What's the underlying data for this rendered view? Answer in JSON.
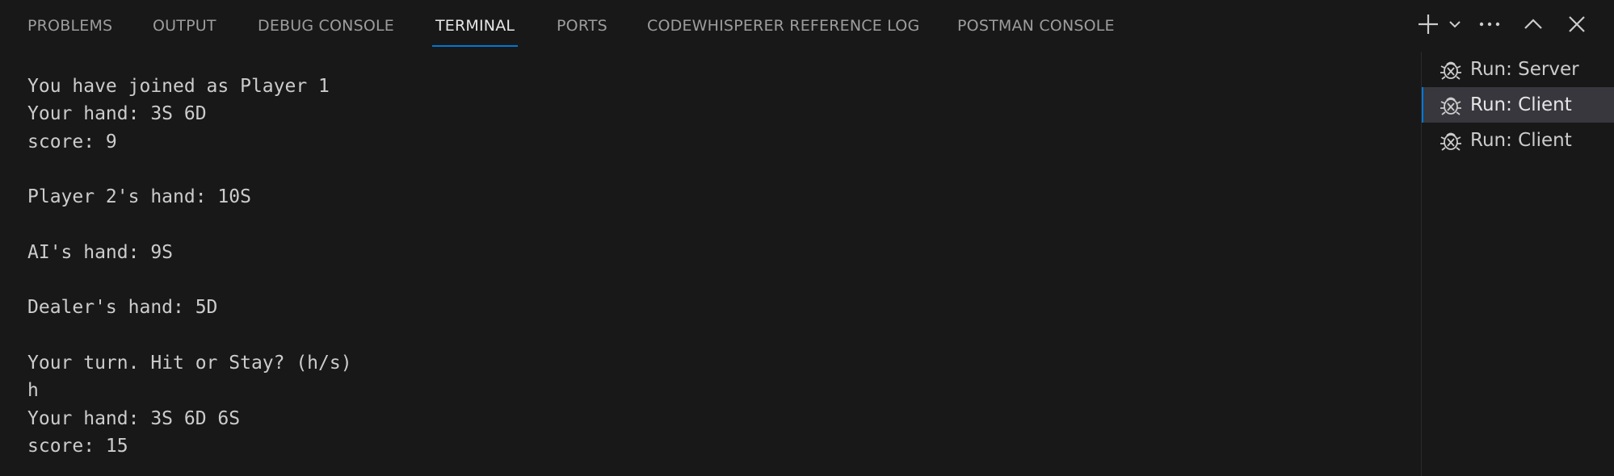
{
  "tabs": [
    {
      "label": "PROBLEMS",
      "active": false
    },
    {
      "label": "OUTPUT",
      "active": false
    },
    {
      "label": "DEBUG CONSOLE",
      "active": false
    },
    {
      "label": "TERMINAL",
      "active": true
    },
    {
      "label": "PORTS",
      "active": false
    },
    {
      "label": "CODEWHISPERER REFERENCE LOG",
      "active": false
    },
    {
      "label": "POSTMAN CONSOLE",
      "active": false
    }
  ],
  "actions": {
    "new_terminal_icon": "plus-icon",
    "launch_profile_icon": "chevron-down-icon",
    "more_icon": "ellipsis-icon",
    "maximize_icon": "chevron-up-icon",
    "close_icon": "close-icon"
  },
  "terminal": {
    "lines": [
      "You have joined as Player 1",
      "Your hand: 3S 6D",
      "score: 9",
      "",
      "Player 2's hand: 10S",
      "",
      "AI's hand: 9S",
      "",
      "Dealer's hand: 5D",
      "",
      "Your turn. Hit or Stay? (h/s)",
      "h",
      "Your hand: 3S 6D 6S",
      "score: 15"
    ]
  },
  "terminal_list": {
    "icon": "debug-icon",
    "items": [
      {
        "label": "Run: Server",
        "active": false
      },
      {
        "label": "Run: Client",
        "active": true
      },
      {
        "label": "Run: Client",
        "active": false
      }
    ]
  },
  "colors": {
    "background": "#181818",
    "accent": "#0078d4",
    "text": "#cccccc",
    "active_row": "#37373d"
  }
}
